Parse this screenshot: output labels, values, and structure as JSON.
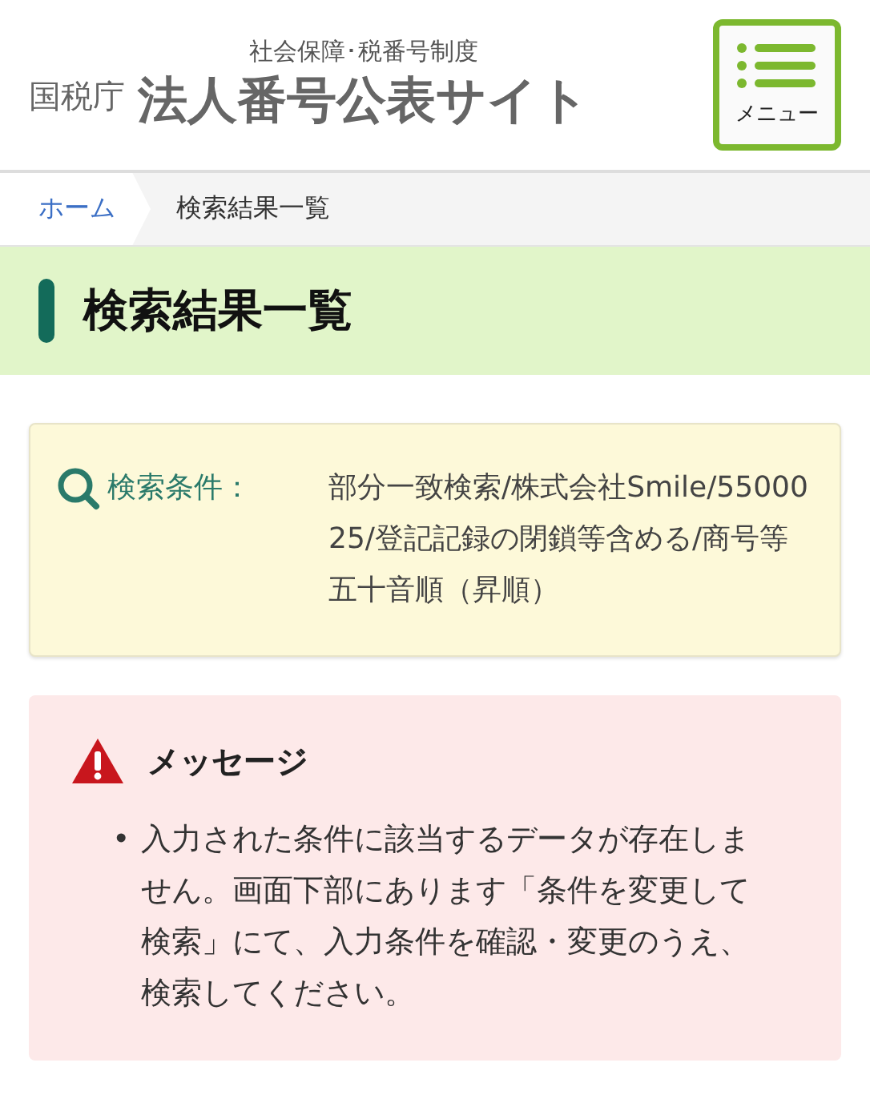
{
  "header": {
    "agency": "国税庁",
    "subtitle": "社会保障･税番号制度",
    "site_title": "法人番号公表サイト",
    "menu_button": "メニュー"
  },
  "breadcrumb": [
    {
      "label": "ホーム",
      "kind": "link"
    },
    {
      "label": "検索結果一覧",
      "kind": "current"
    }
  ],
  "page_title": "検索結果一覧",
  "search_conditions": {
    "label": "検索条件：",
    "value": "部分一致検索/株式会社Smile/5500025/登記記録の閉鎖等含める/商号等五十音順（昇順）"
  },
  "message": {
    "title": "メッセージ",
    "bullet": "•",
    "items": [
      "入力された条件に該当するデータが存在しません。画面下部にあります「条件を変更して検索」にて、入力条件を確認・変更のうえ、検索してください。"
    ]
  }
}
